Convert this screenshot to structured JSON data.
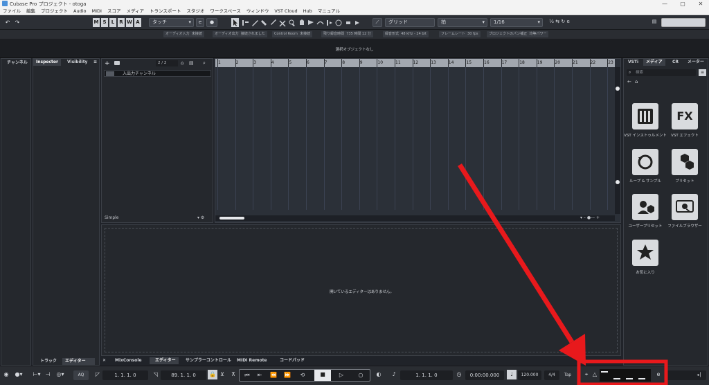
{
  "window": {
    "title": "Cubase Pro プロジェクト - otoga",
    "controls": [
      "—",
      "▢",
      "✕"
    ]
  },
  "menubar": [
    "ファイル",
    "編集",
    "プロジェクト",
    "Audio",
    "MIDI",
    "スコア",
    "メディア",
    "トランスポート",
    "スタジオ",
    "ワークスペース",
    "ウィンドウ",
    "VST Cloud",
    "Hub",
    "マニュアル"
  ],
  "toolbar": {
    "undo": "↶",
    "redo": "↷",
    "msrw": [
      "M",
      "S",
      "L",
      "R",
      "W",
      "A"
    ],
    "automation_mode": "タッチ",
    "snap_type": "グリッド",
    "grid_type": "拍",
    "quantize": "1/16"
  },
  "status": {
    "audio_in_label": "オーディオ入力",
    "audio_in_value": "未接続",
    "audio_out_label": "オーディオ出力",
    "audio_out_value": "接続されました",
    "control_room_label": "Control Room",
    "control_room_value": "未接続",
    "rec_time_label": "残り録音時間",
    "rec_time_value": "735 時間 12 分",
    "rec_format_label": "録音形式",
    "rec_format_value": "48 kHz - 24 bit",
    "frame_rate_label": "フレームレート",
    "frame_rate_value": "30 fps",
    "pan_law_label": "プロジェクトのパン補正",
    "pan_law_value": "均等パワー"
  },
  "info_line": "選択オブジェクトなし",
  "left_zone": {
    "channel_tab": "チャンネル",
    "inspector_tab": "Inspector",
    "visibility_tab": "Visibility",
    "bottom_tabs": [
      "トラック",
      "エディター"
    ]
  },
  "track_list": {
    "count": "2 / 2",
    "tracks": [
      {
        "name": "入出力チャンネル"
      }
    ],
    "preset": "Simple"
  },
  "ruler": {
    "bars": [
      "1",
      "2",
      "3",
      "4",
      "5",
      "6",
      "7",
      "8",
      "9",
      "10",
      "11",
      "12",
      "13",
      "14",
      "15",
      "16",
      "17",
      "18",
      "19",
      "20",
      "21",
      "22",
      "23"
    ]
  },
  "lower_zone": {
    "message": "開いているエディターはありません。",
    "tabs": [
      "MixConsole",
      "エディター",
      "サンプラーコントロール",
      "MIDI Remote",
      "コードパッド"
    ],
    "close": "✕"
  },
  "right_zone": {
    "tabs": [
      "VSTi",
      "メディア",
      "CR",
      "メーター"
    ],
    "search_placeholder": "検索",
    "tiles": [
      {
        "label": "VST インストゥルメント",
        "icon": "piano-keys-icon"
      },
      {
        "label": "VST エフェクト",
        "icon": "fx-icon",
        "glyph": "FX"
      },
      {
        "label": "ループ & サンプル",
        "icon": "loop-icon"
      },
      {
        "label": "プリセット",
        "icon": "preset-hexagon-icon"
      },
      {
        "label": "ユーザープリセット",
        "icon": "user-preset-icon"
      },
      {
        "label": "ファイルブラウザー",
        "icon": "file-browser-icon"
      },
      {
        "label": "お気に入り",
        "icon": "star-icon"
      }
    ]
  },
  "transport": {
    "aq": "AQ",
    "left_locator": "1. 1. 1.  0",
    "right_locator": "89. 1. 1.  0",
    "primary_time": "1. 1. 1.  0",
    "secondary_time": "0:00:00.000",
    "tempo": "120.000",
    "signature": "4/4",
    "tap": "Tap"
  },
  "annotation": {
    "color": "#e8191c"
  }
}
